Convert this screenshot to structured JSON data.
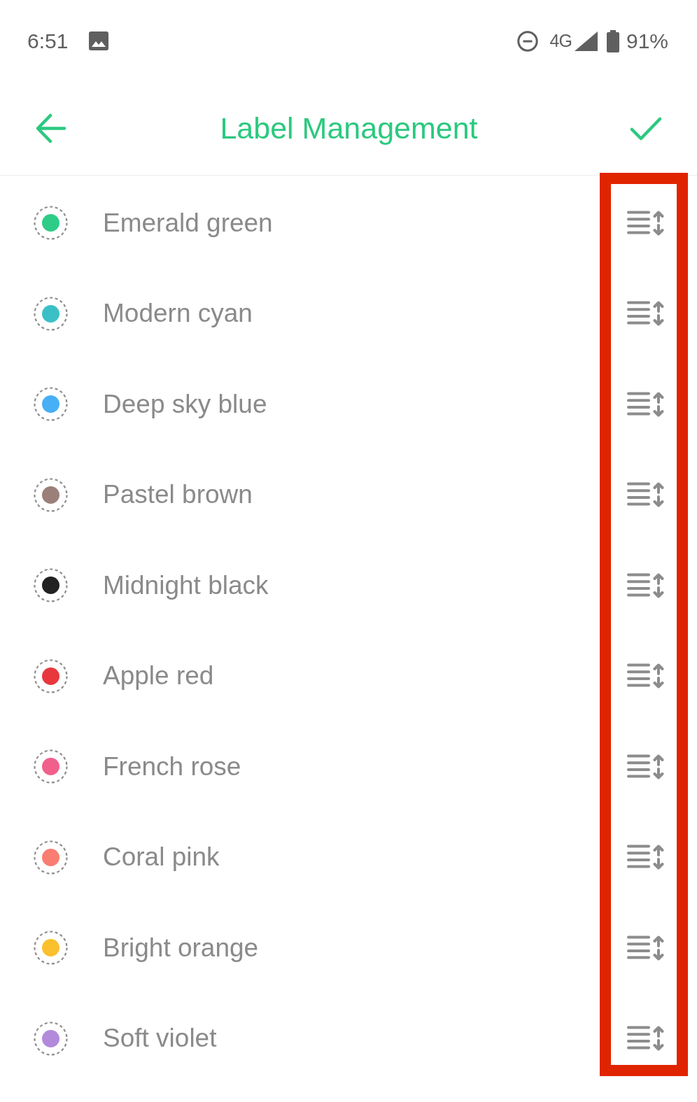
{
  "status_bar": {
    "time": "6:51",
    "network": "4G",
    "battery": "91%"
  },
  "header": {
    "title": "Label Management"
  },
  "labels": [
    {
      "name": "Emerald green",
      "color": "#2ecc87"
    },
    {
      "name": "Modern cyan",
      "color": "#3bbfc6"
    },
    {
      "name": "Deep sky blue",
      "color": "#46aff5"
    },
    {
      "name": "Pastel brown",
      "color": "#9b8079"
    },
    {
      "name": "Midnight black",
      "color": "#222222"
    },
    {
      "name": "Apple red",
      "color": "#e8383d"
    },
    {
      "name": "French rose",
      "color": "#f0608b"
    },
    {
      "name": "Coral pink",
      "color": "#fa7d72"
    },
    {
      "name": "Bright orange",
      "color": "#fbc02d"
    },
    {
      "name": "Soft violet",
      "color": "#b389dc"
    }
  ],
  "highlight": {
    "kind": "frame"
  }
}
